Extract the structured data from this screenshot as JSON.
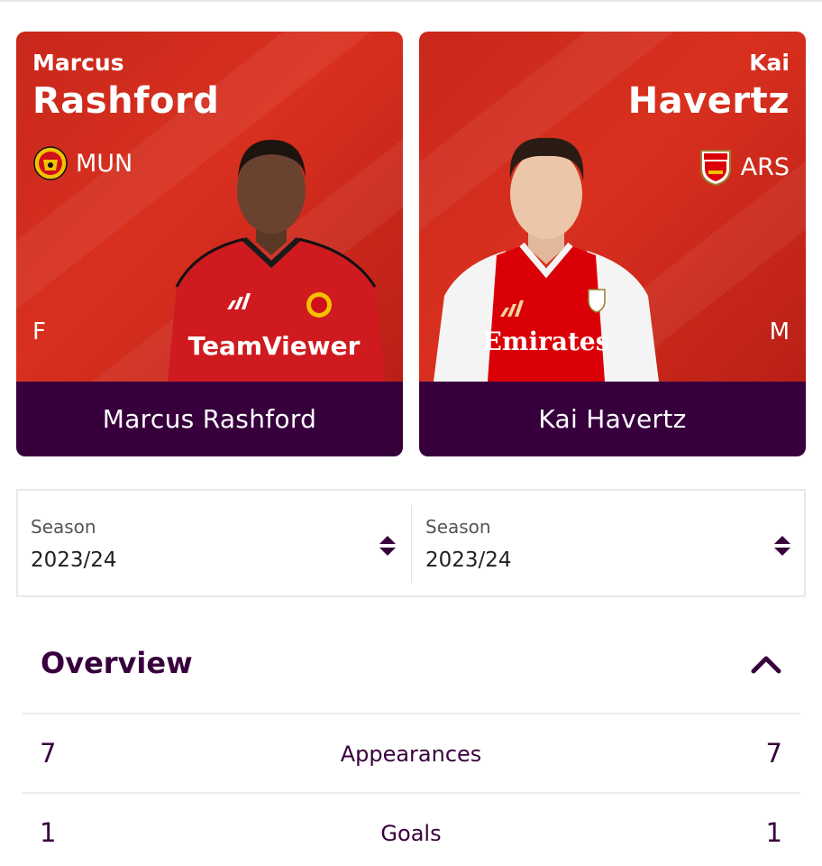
{
  "players": [
    {
      "first_name": "Marcus",
      "last_name": "Rashford",
      "club": "MUN",
      "position": "F",
      "full_name": "Marcus Rashford",
      "crest_icon": "man-utd-crest-icon",
      "shirt_color": "#d0101b",
      "shirt_text": "TeamViewer"
    },
    {
      "first_name": "Kai",
      "last_name": "Havertz",
      "club": "ARS",
      "position": "M",
      "full_name": "Kai Havertz",
      "crest_icon": "arsenal-crest-icon",
      "shirt_color": "#db0007",
      "shirt_text": "Emirates"
    }
  ],
  "seasons": [
    {
      "label": "Season",
      "value": "2023/24"
    },
    {
      "label": "Season",
      "value": "2023/24"
    }
  ],
  "overview": {
    "title": "Overview",
    "stats": [
      {
        "label": "Appearances",
        "left": "7",
        "right": "7"
      },
      {
        "label": "Goals",
        "left": "1",
        "right": "1"
      }
    ]
  },
  "colors": {
    "brand_purple": "#37003c",
    "card_red": "#d42d1f"
  }
}
